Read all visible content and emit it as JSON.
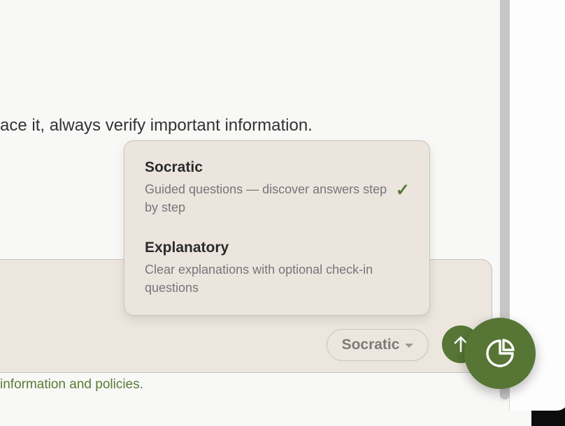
{
  "content": {
    "disclaimer": "ace it, always verify important information."
  },
  "composer": {
    "mode_selected": "Socratic",
    "send_icon": "arrow-up-icon"
  },
  "footer": {
    "link_text": "information and policies",
    "suffix": "."
  },
  "mode_menu": {
    "items": [
      {
        "title": "Socratic",
        "description": "Guided questions — discover answers step by step",
        "selected": true,
        "check": "✓"
      },
      {
        "title": "Explanatory",
        "description": "Clear explanations with optional check-in questions",
        "selected": false
      }
    ]
  },
  "fab": {
    "icon": "pie-chart-icon"
  },
  "colors": {
    "accent": "#577636",
    "menu_bg": "#ebe5de",
    "composer_bg": "#ece6df",
    "link": "#597a33"
  }
}
